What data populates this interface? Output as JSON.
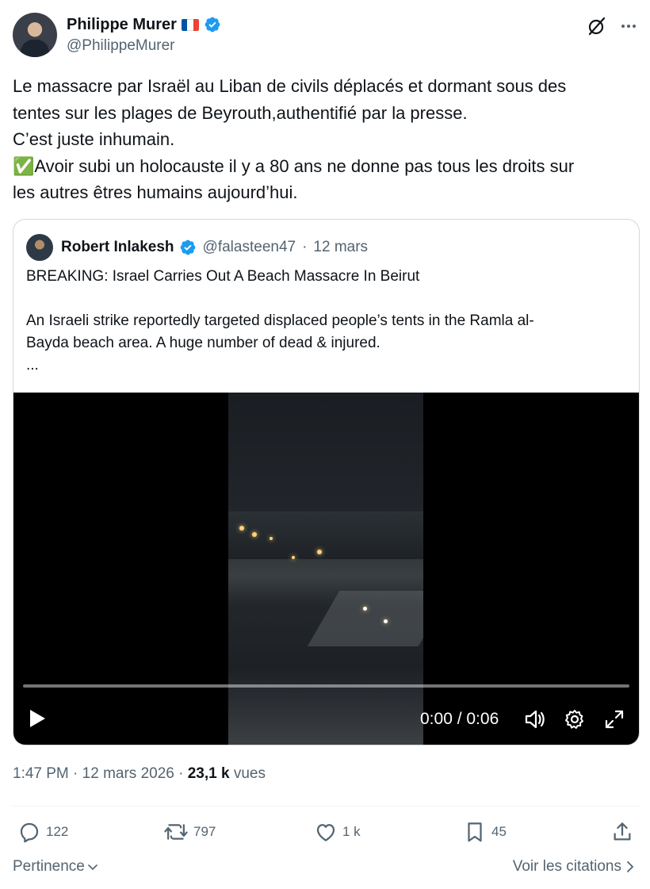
{
  "author": {
    "name": "Philippe Murer",
    "handle": "@PhilippeMurer",
    "flag_colors": [
      "#0055a4",
      "#ffffff",
      "#ef4135"
    ],
    "verified_color": "#1d9bf0"
  },
  "header_icons": [
    "grok-icon",
    "more-icon"
  ],
  "tweet": {
    "text": "Le massacre par Israël au Liban de civils déplacés et dormant sous des\ntentes sur les plages de Beyrouth,authentifié par la presse.\nC’est juste inhumain.\n✅Avoir subi un holocauste il y a 80 ans ne donne pas tous les droits sur\nles autres êtres humains aujourd’hui."
  },
  "quote": {
    "name": "Robert Inlakesh",
    "handle": "@falasteen47",
    "separator": "·",
    "date": "12 mars",
    "text": "BREAKING: Israel Carries Out A Beach Massacre In Beirut\n\nAn Israeli strike reportedly targeted displaced people’s tents in the Ramla al-\nBayda beach area. A huge number of dead & injured.\n..."
  },
  "video": {
    "time": "0:00 / 0:06",
    "progress": 0,
    "controls": [
      "play-icon",
      "volume-icon",
      "settings-icon",
      "fullscreen-icon"
    ]
  },
  "meta": {
    "time": "1:47 PM",
    "sep1": "·",
    "date": "12 mars 2026",
    "sep2": "·",
    "views": "23,1 k",
    "views_label": "vues"
  },
  "actions": {
    "replies": "122",
    "reposts": "797",
    "likes": "1 k",
    "bookmarks": "45"
  },
  "footer": {
    "sort_label": "Pertinence",
    "quotes_label": "Voir les citations"
  }
}
